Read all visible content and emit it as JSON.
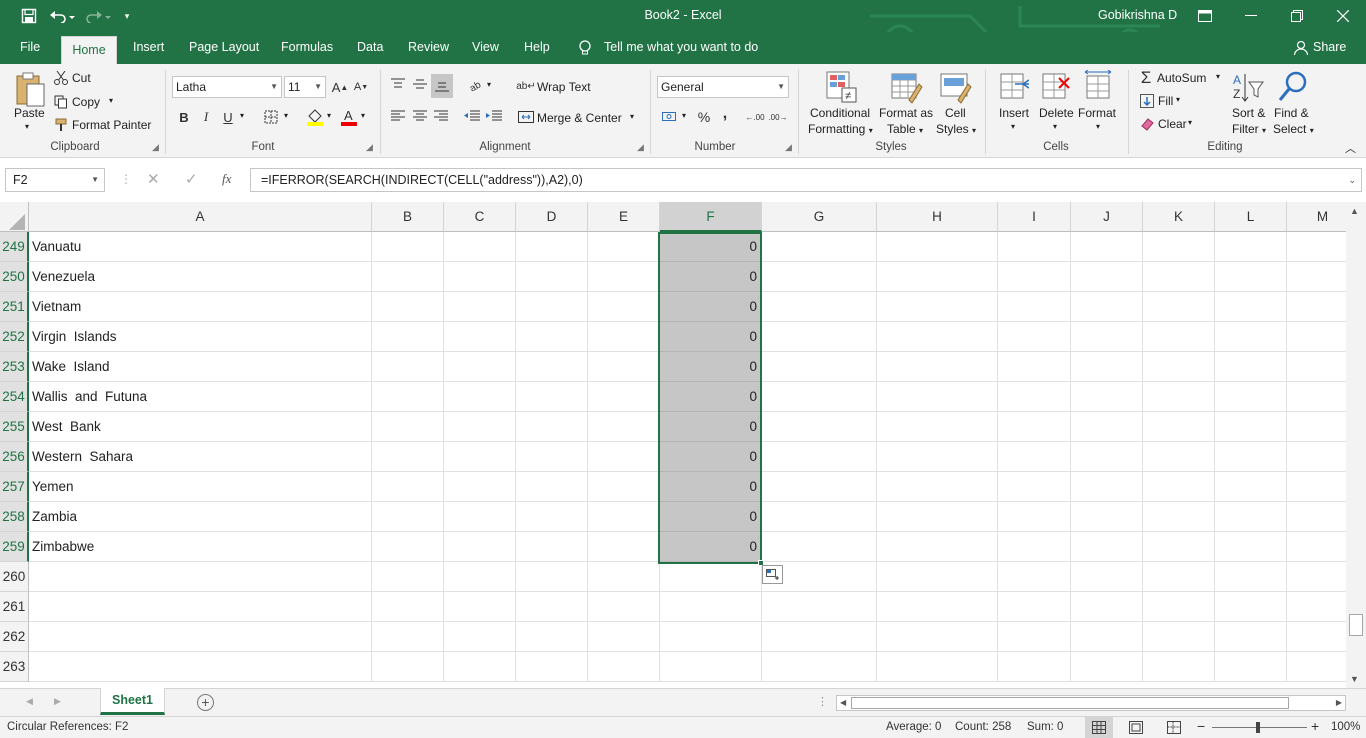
{
  "app": {
    "title": "Book2 - Excel",
    "user": "Gobikrishna D"
  },
  "ribbon_tabs": [
    "File",
    "Home",
    "Insert",
    "Page Layout",
    "Formulas",
    "Data",
    "Review",
    "View",
    "Help"
  ],
  "tell_me": "Tell me what you want to do",
  "share": "Share",
  "clipboard": {
    "paste": "Paste",
    "cut": "Cut",
    "copy": "Copy",
    "format_painter": "Format Painter",
    "label": "Clipboard"
  },
  "font": {
    "name": "Latha",
    "size": "11",
    "label": "Font",
    "bold": "B",
    "italic": "I",
    "underline": "U"
  },
  "alignment": {
    "wrap": "Wrap Text",
    "merge": "Merge & Center",
    "label": "Alignment"
  },
  "number": {
    "format": "General",
    "percent": "%",
    "comma": ",",
    "label": "Number",
    "inc_dec": ".00",
    "dec_dec": ".00"
  },
  "styles": {
    "conditional": "Conditional",
    "formatting": "Formatting",
    "format_as": "Format as",
    "table": "Table",
    "cell": "Cell",
    "cell_styles": "Styles",
    "label": "Styles"
  },
  "cells": {
    "insert": "Insert",
    "delete": "Delete",
    "format": "Format",
    "label": "Cells"
  },
  "editing": {
    "autosum": "AutoSum",
    "fill": "Fill",
    "clear": "Clear",
    "sort": "Sort &",
    "filter": "Filter",
    "find": "Find &",
    "select": "Select",
    "label": "Editing"
  },
  "formula_bar": {
    "name_box": "F2",
    "cancel": "✕",
    "enter": "✓",
    "fx": "fx",
    "formula": "=IFERROR(SEARCH(INDIRECT(CELL(\"address\")),A2),0)"
  },
  "columns": [
    "A",
    "B",
    "C",
    "D",
    "E",
    "F",
    "G",
    "H",
    "I",
    "J",
    "K",
    "L",
    "M"
  ],
  "rows": [
    {
      "num": "249",
      "a": "Vanuatu",
      "f": "0"
    },
    {
      "num": "250",
      "a": "Venezuela",
      "f": "0"
    },
    {
      "num": "251",
      "a": "Vietnam",
      "f": "0"
    },
    {
      "num": "252",
      "a": "Virgin  Islands",
      "f": "0"
    },
    {
      "num": "253",
      "a": "Wake  Island",
      "f": "0"
    },
    {
      "num": "254",
      "a": "Wallis  and  Futuna",
      "f": "0"
    },
    {
      "num": "255",
      "a": "West  Bank",
      "f": "0"
    },
    {
      "num": "256",
      "a": "Western  Sahara",
      "f": "0"
    },
    {
      "num": "257",
      "a": "Yemen",
      "f": "0"
    },
    {
      "num": "258",
      "a": "Zambia",
      "f": "0"
    },
    {
      "num": "259",
      "a": "Zimbabwe",
      "f": "0"
    },
    {
      "num": "260",
      "a": "",
      "f": ""
    },
    {
      "num": "261",
      "a": "",
      "f": ""
    },
    {
      "num": "262",
      "a": "",
      "f": ""
    },
    {
      "num": "263",
      "a": "",
      "f": ""
    }
  ],
  "sheet": {
    "name": "Sheet1"
  },
  "status": {
    "left": "Circular References: F2",
    "average": "Average: 0",
    "count": "Count: 258",
    "sum": "Sum: 0",
    "zoom": "100%"
  },
  "colors": {
    "accent": "#217346",
    "ribbon_bg": "#f3f3f3",
    "selection": "#c6c6c6"
  }
}
